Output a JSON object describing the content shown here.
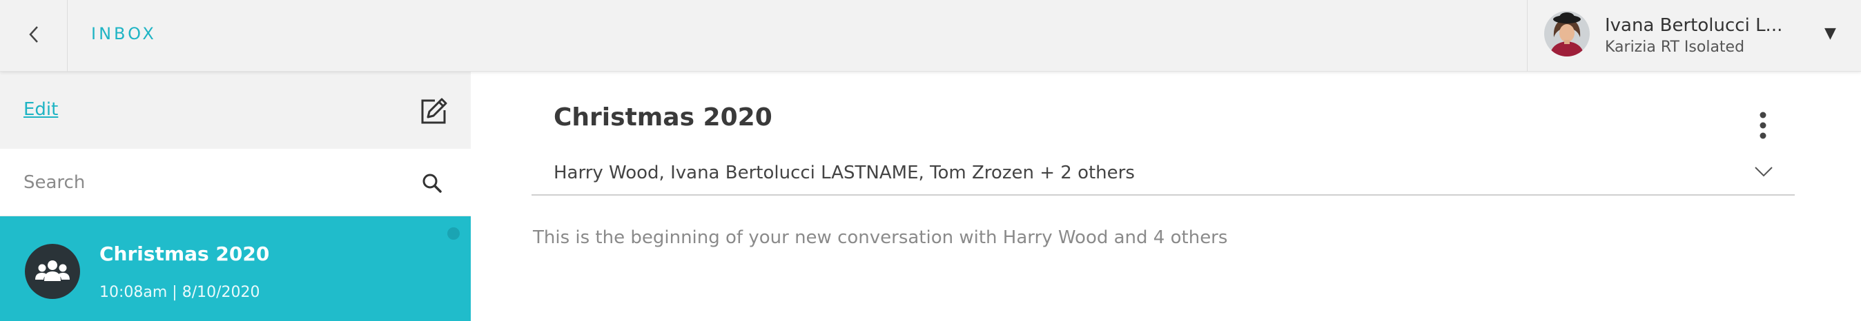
{
  "header": {
    "back_icon": "chevron-left-icon",
    "title": "INBOX",
    "user": {
      "name": "Ivana Bertolucci L...",
      "account": "Karizia RT Isolated",
      "avatar": "user-photo-avatar",
      "menu_icon": "caret-down-icon"
    }
  },
  "sidebar": {
    "edit_label": "Edit",
    "compose_icon": "compose-icon",
    "search": {
      "placeholder": "Search",
      "value": "",
      "icon": "search-icon"
    },
    "conversations": [
      {
        "title": "Christmas 2020",
        "timestamp": "10:08am | 8/10/2020",
        "avatar_icon": "group-icon",
        "selected": true
      }
    ]
  },
  "main": {
    "title": "Christmas 2020",
    "more_icon": "kebab-menu-icon",
    "participants": "Harry Wood, Ivana Bertolucci LASTNAME, Tom Zrozen + 2 others",
    "expand_icon": "chevron-down-icon",
    "beginning_note": "This is the beginning of your new conversation with Harry Wood and 4 others"
  },
  "colors": {
    "accent": "#1fb4c4",
    "selected_row": "#20bccb",
    "header_bg": "#f2f2f2",
    "group_avatar_bg": "#2a3338"
  }
}
